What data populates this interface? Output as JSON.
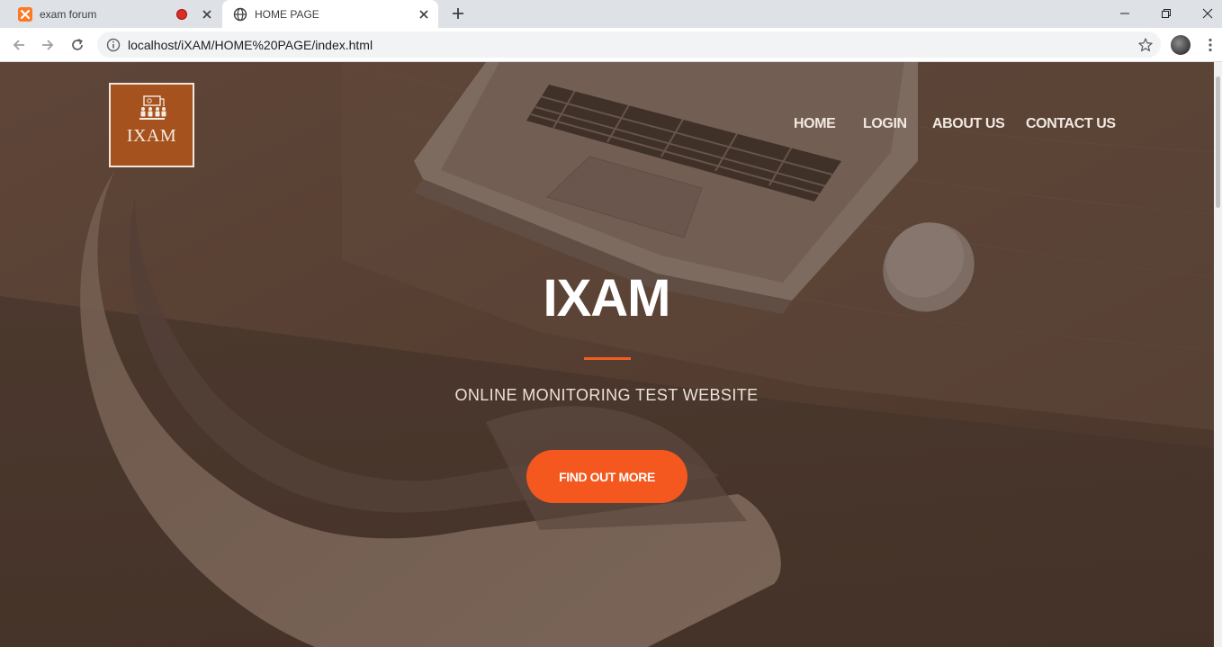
{
  "browser": {
    "tabs": [
      {
        "title": "exam forum",
        "icon": "xampp-icon",
        "recording": true,
        "active": false
      },
      {
        "title": "HOME PAGE",
        "icon": "globe-icon",
        "active": true
      }
    ],
    "address_bar": {
      "url": "localhost/iXAM/HOME%20PAGE/index.html"
    }
  },
  "page": {
    "logo": {
      "text": "IXAM"
    },
    "nav": {
      "home": "HOME",
      "login": "LOGIN",
      "about": "ABOUT US",
      "contact": "CONTACT US"
    },
    "hero": {
      "title": "IXAM",
      "subtitle": "ONLINE MONITORING TEST WEBSITE",
      "cta_label": "FIND OUT MORE"
    }
  },
  "colors": {
    "accent": "#f4581e",
    "logo_bg": "#a5521e",
    "overlay": "#4f3c33"
  }
}
